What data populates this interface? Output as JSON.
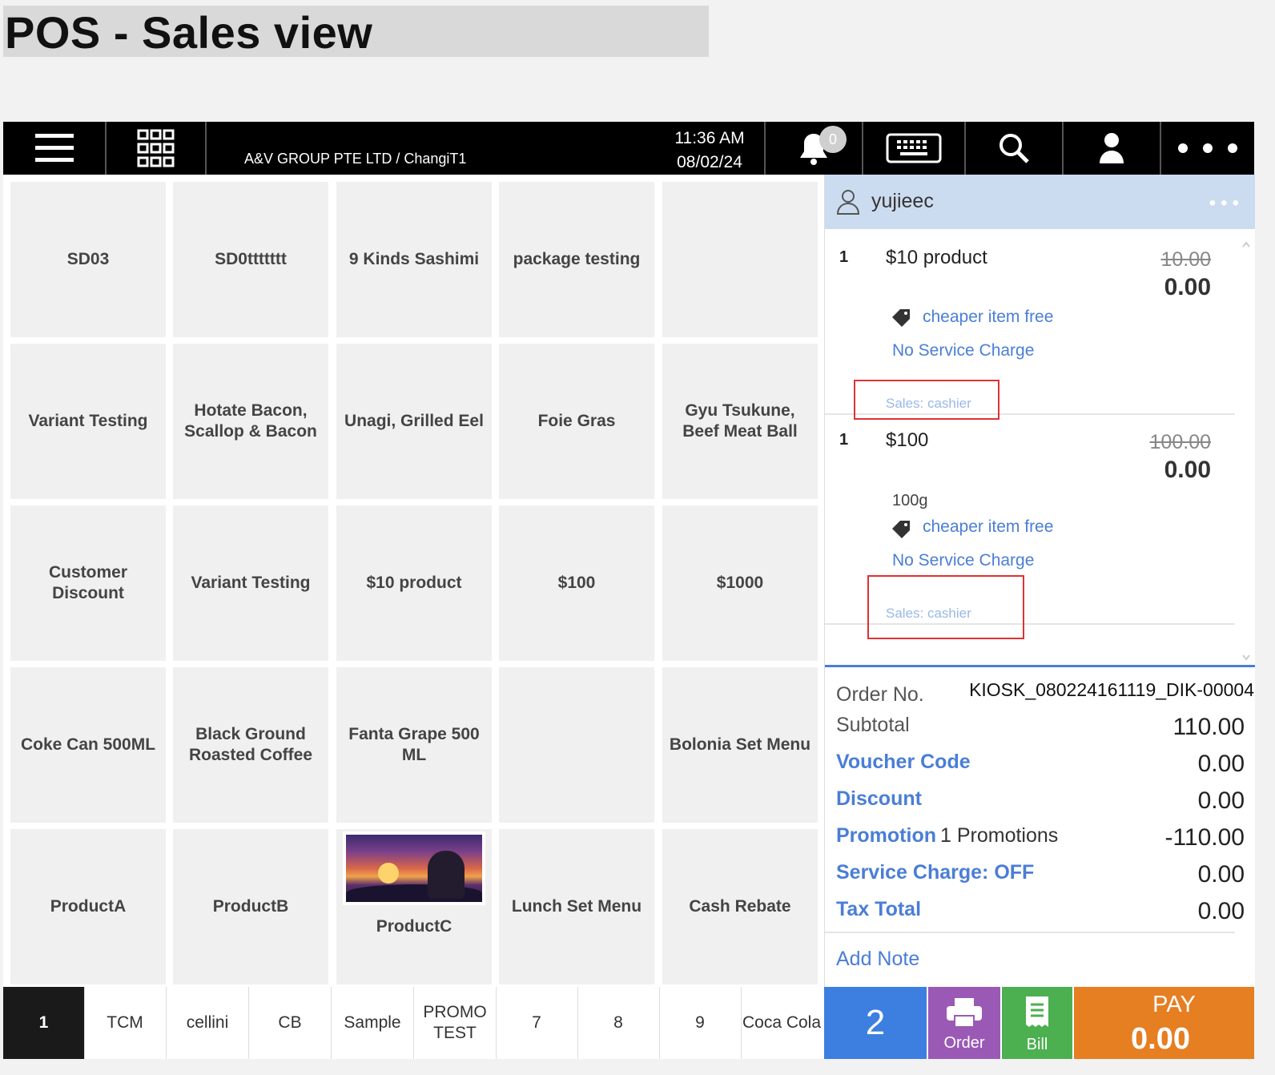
{
  "page_title": "POS - Sales view",
  "topbar": {
    "company": "A&V GROUP PTE LTD / ChangiT1",
    "time": "11:36 AM",
    "date": "08/02/24",
    "notification_count": "0"
  },
  "products": [
    [
      "SD03",
      "SD0ttttttt",
      "9 Kinds Sashimi",
      "package testing",
      ""
    ],
    [
      "Variant Testing",
      "Hotate Bacon, Scallop & Bacon",
      "Unagi, Grilled Eel",
      "Foie Gras",
      "Gyu Tsukune, Beef Meat Ball"
    ],
    [
      "Customer Discount",
      "Variant Testing",
      "$10 product",
      "$100",
      "$1000"
    ],
    [
      "Coke Can 500ML",
      "Black Ground Roasted Coffee",
      "Fanta Grape 500 ML",
      "",
      "Bolonia Set Menu"
    ],
    [
      "ProductA",
      "ProductB",
      "ProductC",
      "Lunch Set Menu",
      "Cash Rebate"
    ]
  ],
  "categories": [
    "1",
    "TCM",
    "cellini",
    "CB",
    "Sample",
    "PROMO TEST",
    "7",
    "8",
    "9",
    "Coca Cola"
  ],
  "cart": {
    "user": "yujieec",
    "items": [
      {
        "qty": "1",
        "name": "$10 product",
        "old_price": "10.00",
        "price": "0.00",
        "variant": "",
        "promo": "cheaper item free",
        "service": "No Service Charge",
        "sales": "Sales: cashier"
      },
      {
        "qty": "1",
        "name": "$100",
        "old_price": "100.00",
        "price": "0.00",
        "variant": "100g",
        "promo": "cheaper item free",
        "service": "No Service Charge",
        "sales": "Sales: cashier"
      }
    ]
  },
  "summary": {
    "order_label": "Order No.",
    "order_no": "KIOSK_080224161119_DIK-00004",
    "subtotal_label": "Subtotal",
    "subtotal": "110.00",
    "voucher_label": "Voucher Code",
    "voucher": "0.00",
    "discount_label": "Discount",
    "discount": "0.00",
    "promotion_label": "Promotion",
    "promotion_count": "1 Promotions",
    "promotion": "-110.00",
    "service_label": "Service Charge: OFF",
    "service": "0.00",
    "tax_label": "Tax Total",
    "tax": "0.00",
    "add_note": "Add Note"
  },
  "actions": {
    "count": "2",
    "order": "Order",
    "bill": "Bill",
    "pay": "PAY",
    "pay_amount": "0.00"
  },
  "colors": {
    "accent_blue": "#4a7ed6",
    "order_purple": "#9b59b6",
    "bill_green": "#4caf50",
    "pay_orange": "#e67e22"
  }
}
